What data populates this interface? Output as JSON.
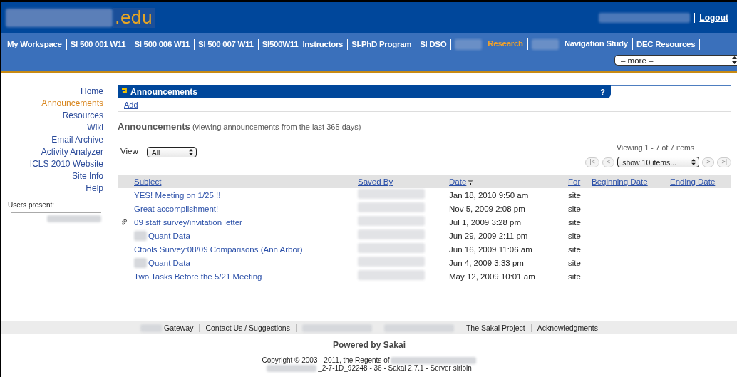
{
  "header": {
    "site_suffix": ".edu",
    "logout": "Logout"
  },
  "nav": [
    {
      "label": "My Workspace",
      "selected": false,
      "redacted_prefix": false
    },
    {
      "label": "SI 500 001 W11",
      "selected": false,
      "redacted_prefix": false
    },
    {
      "label": "SI 500 006 W11",
      "selected": false,
      "redacted_prefix": false
    },
    {
      "label": "SI 500 007 W11",
      "selected": false,
      "redacted_prefix": false
    },
    {
      "label": "SI500W11_Instructors",
      "selected": false,
      "redacted_prefix": false
    },
    {
      "label": "SI-PhD Program",
      "selected": false,
      "redacted_prefix": false
    },
    {
      "label": "SI DSO",
      "selected": false,
      "redacted_prefix": false
    },
    {
      "label": "Research",
      "selected": true,
      "redacted_prefix": true
    },
    {
      "label": "Navigation Study",
      "selected": false,
      "redacted_prefix": true
    },
    {
      "label": "DEC Resources",
      "selected": false,
      "redacted_prefix": false
    }
  ],
  "more_select": {
    "value": "– more –"
  },
  "sidebar": {
    "items": [
      {
        "label": "Home",
        "selected": false
      },
      {
        "label": "Announcements",
        "selected": true
      },
      {
        "label": "Resources",
        "selected": false
      },
      {
        "label": "Wiki",
        "selected": false
      },
      {
        "label": "Email Archive",
        "selected": false
      },
      {
        "label": "Activity Analyzer",
        "selected": false
      },
      {
        "label": "ICLS 2010 Website",
        "selected": false
      },
      {
        "label": "Site Info",
        "selected": false
      },
      {
        "label": "Help",
        "selected": false
      }
    ],
    "users_present": "Users present:"
  },
  "tool": {
    "title": "Announcements",
    "help": "?",
    "add": "Add",
    "heading": "Announcements",
    "heading_note": "(viewing announcements from the last 365 days)",
    "view_label": "View",
    "view_value": "All",
    "viewing": "Viewing 1 - 7 of 7 items",
    "page_size": "show 10 items...",
    "pager": [
      "|<",
      "<",
      ">",
      ">|"
    ]
  },
  "table": {
    "columns": [
      "Subject",
      "Saved By",
      "Date",
      "For",
      "Beginning Date",
      "Ending Date"
    ],
    "rows": [
      {
        "subject": "YES! Meeting on 1/25 !!",
        "attachment": false,
        "redacted_prefix": false,
        "date": "Jan 18, 2010 9:50 am",
        "for": "site"
      },
      {
        "subject": "Great accomplishment!",
        "attachment": false,
        "redacted_prefix": false,
        "date": "Nov 5, 2009 2:08 pm",
        "for": "site"
      },
      {
        "subject": "09 staff survey/invitation letter",
        "attachment": true,
        "redacted_prefix": false,
        "date": "Jul 1, 2009 3:28 pm",
        "for": "site"
      },
      {
        "subject": "Quant Data",
        "attachment": false,
        "redacted_prefix": true,
        "date": "Jun 29, 2009 2:11 pm",
        "for": "site"
      },
      {
        "subject": "Ctools Survey:08/09 Comparisons (Ann Arbor)",
        "attachment": false,
        "redacted_prefix": false,
        "date": "Jun 16, 2009 11:06 am",
        "for": "site"
      },
      {
        "subject": "Quant Data",
        "attachment": false,
        "redacted_prefix": true,
        "date": "Jun 4, 2009 3:33 pm",
        "for": "site"
      },
      {
        "subject": "Two Tasks Before the 5/21 Meeting",
        "attachment": false,
        "redacted_prefix": false,
        "date": "May 12, 2009 10:01 am",
        "for": "site"
      }
    ]
  },
  "footer": {
    "links": [
      {
        "kind": "link",
        "label": "Gateway",
        "redacted_prefix": true
      },
      {
        "kind": "link",
        "label": "Contact Us / Suggestions",
        "redacted_prefix": false
      },
      {
        "kind": "redacted"
      },
      {
        "kind": "redacted"
      },
      {
        "kind": "link",
        "label": "The Sakai Project",
        "redacted_prefix": false
      },
      {
        "kind": "link",
        "label": "Acknowledgments",
        "redacted_prefix": false
      }
    ],
    "powered": "Powered by Sakai",
    "copyright": "Copyright © 2003 - 2011, the Regents of",
    "build": "_2-7-1D_92248 - 36 - Sakai 2.7.1 - Server sirloin"
  }
}
